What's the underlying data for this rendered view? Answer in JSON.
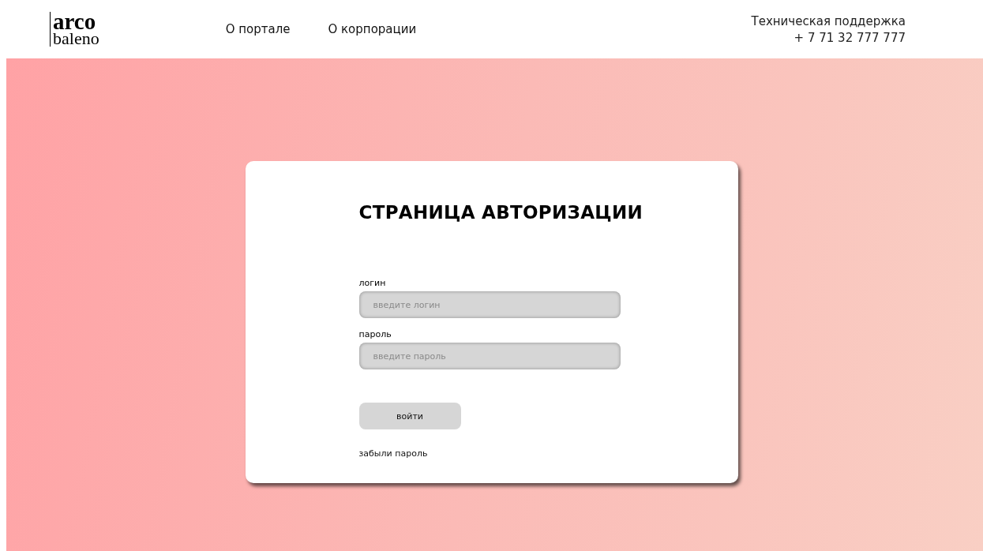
{
  "logo": {
    "line1": "arco",
    "line2": "baleno"
  },
  "nav": [
    "О портале",
    "О корпорации"
  ],
  "support": {
    "label": "Техническая поддержка",
    "phone": "+ 7 71 32 777 777"
  },
  "login_card": {
    "title": "СТРАНИЦА АВТОРИЗАЦИИ",
    "fields": [
      {
        "label": "логин",
        "placeholder": "введите логин"
      },
      {
        "label": "пароль",
        "placeholder": "введите пароль"
      }
    ],
    "submit": "войти",
    "forgot_link": "забыли пароль"
  }
}
